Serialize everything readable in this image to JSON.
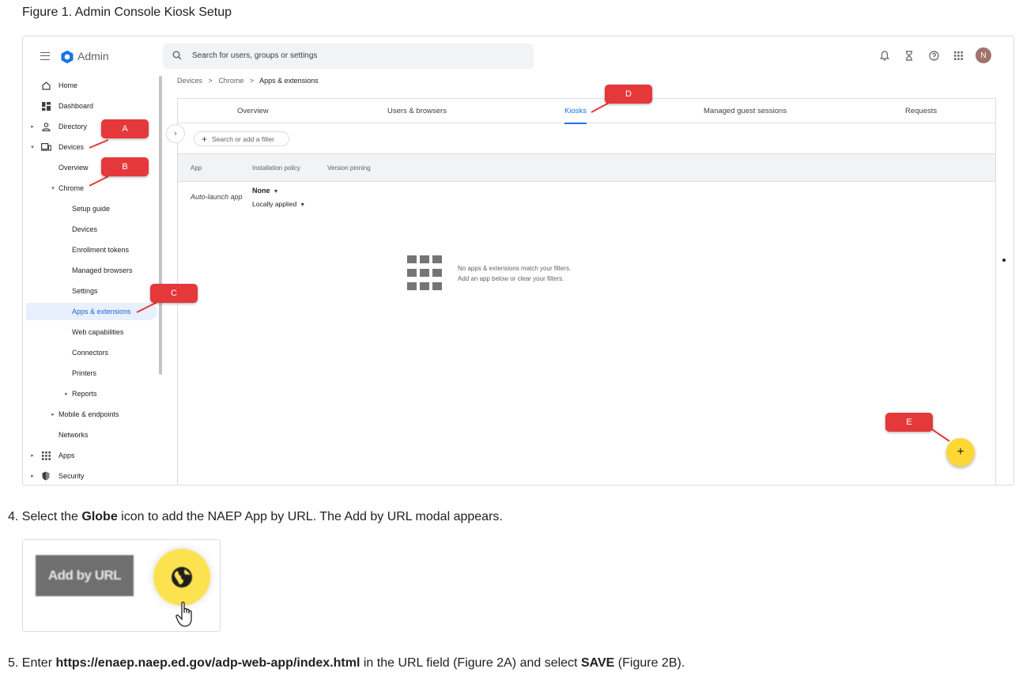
{
  "doc": {
    "figure_caption": "Figure 1. Admin Console Kiosk Setup",
    "step4": {
      "prefix": "4. Select the ",
      "bold": "Globe",
      "suffix": " icon to add the NAEP App by URL. The Add by URL modal appears."
    },
    "step5": {
      "prefix": "5. Enter ",
      "bold_url": "https://enaep.naep.ed.gov/adp-web-app/index.html",
      "middle": " in the URL field (Figure 2A) and select ",
      "bold_save": "SAVE",
      "suffix": " (Figure 2B)."
    }
  },
  "admin": {
    "title": "Admin",
    "search_placeholder": "Search for users, groups or settings",
    "avatar_initial": "N",
    "icons": [
      "bell-icon",
      "hourglass-icon",
      "help-icon",
      "apps-grid-icon"
    ],
    "sidebar": {
      "items": [
        {
          "label": "Home",
          "icon": "home-icon"
        },
        {
          "label": "Dashboard",
          "icon": "dashboard-icon"
        },
        {
          "label": "Directory",
          "icon": "person-icon"
        },
        {
          "label": "Devices",
          "icon": "devices-icon"
        },
        {
          "label": "Overview"
        },
        {
          "label": "Chrome"
        },
        {
          "label": "Setup guide"
        },
        {
          "label": "Devices"
        },
        {
          "label": "Enrollment tokens"
        },
        {
          "label": "Managed browsers"
        },
        {
          "label": "Settings"
        },
        {
          "label": "Apps & extensions"
        },
        {
          "label": "Web capabilities"
        },
        {
          "label": "Connectors"
        },
        {
          "label": "Printers"
        },
        {
          "label": "Reports"
        },
        {
          "label": "Mobile & endpoints"
        },
        {
          "label": "Networks"
        },
        {
          "label": "Apps",
          "icon": "apps-icon"
        },
        {
          "label": "Security",
          "icon": "shield-icon"
        }
      ]
    },
    "breadcrumb": {
      "parts": [
        "Devices",
        "Chrome"
      ],
      "current": "Apps & extensions",
      "separator": ">"
    },
    "tabs": [
      {
        "label": "Overview"
      },
      {
        "label": "Users & browsers"
      },
      {
        "label": "Kiosks",
        "active": true
      },
      {
        "label": "Managed guest sessions"
      },
      {
        "label": "Requests"
      }
    ],
    "filter_placeholder": "Search or add a filter",
    "table": {
      "columns": [
        "App",
        "Installation policy",
        "Version pinning"
      ],
      "row_label": "Auto-launch app",
      "policy_value": "None",
      "policy_scope": "Locally applied"
    },
    "empty_state": {
      "line1": "No apps & extensions match your filters.",
      "line2": "Add an app below or clear your filters."
    },
    "fab_label": "+",
    "callouts": [
      "A",
      "B",
      "C",
      "D",
      "E"
    ]
  },
  "figure2": {
    "add_url_label": "Add by URL",
    "fab_color": "#fde24f"
  },
  "colors": {
    "accent": "#1a73e8",
    "callout": "#e5383b",
    "fab": "#fdd835"
  }
}
